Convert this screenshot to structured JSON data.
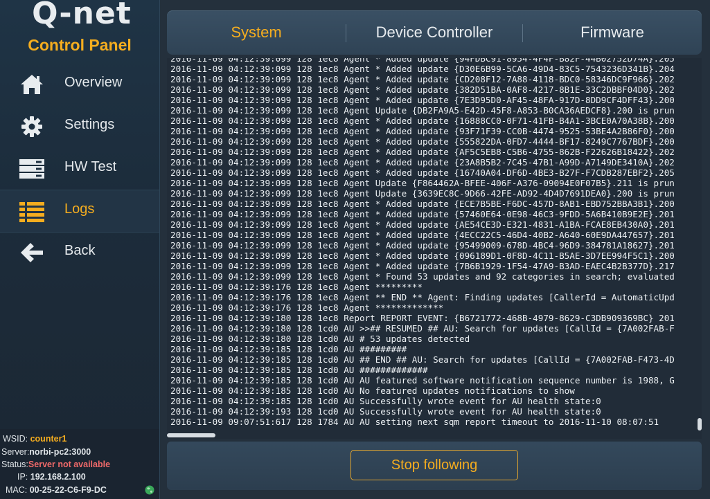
{
  "app": {
    "logo_text": "Q-net",
    "subtitle": "Control Panel"
  },
  "sidebar": {
    "items": [
      {
        "label": "Overview",
        "icon": "home-icon",
        "active": false
      },
      {
        "label": "Settings",
        "icon": "gear-icon",
        "active": false
      },
      {
        "label": "HW Test",
        "icon": "server-icon",
        "active": false
      },
      {
        "label": "Logs",
        "icon": "list-icon",
        "active": true
      },
      {
        "label": "Back",
        "icon": "arrow-left-icon",
        "active": false
      }
    ]
  },
  "info": {
    "wsid_label": "WSID:",
    "wsid_value": "counter1",
    "server_label": "Server:",
    "server_value": "norbi-pc2:3000",
    "status_label": "Status:",
    "status_value": "Server not available",
    "ip_label": "IP:",
    "ip_value": "192.168.2.100",
    "mac_label": "MAC:",
    "mac_value": "00-25-22-C6-F9-DC",
    "status_icon": "globe-icon"
  },
  "tabs": [
    {
      "label": "System",
      "active": true
    },
    {
      "label": "Device Controller",
      "active": false
    },
    {
      "label": "Firmware",
      "active": false
    }
  ],
  "log": {
    "lines": [
      "2016-11-09 04:12:39:099 128 1ec8 Agent * Added update {94FDBC91-8954-4F4F-B82F-44B02752D74A}.205",
      "2016-11-09 04:12:39:099 128 1ec8 Agent * Added update {D30E6B99-5CA6-49D4-83C5-7543236D341B}.204",
      "2016-11-09 04:12:39:099 128 1ec8 Agent * Added update {CD208F12-7A88-4118-BDC0-58346DC9F966}.202",
      "2016-11-09 04:12:39:099 128 1ec8 Agent * Added update {382D51BA-0AF8-4217-8B1E-33C2DBBF04D0}.202",
      "2016-11-09 04:12:39:099 128 1ec8 Agent * Added update {7E3D95D0-AF45-48FA-917D-8DD9CF4DFF43}.200",
      "2016-11-09 04:12:39:099 128 1ec8 Agent Update {DB2FA9A5-E42D-45F8-A853-B0CA36AEDCF8}.200 is prun",
      "2016-11-09 04:12:39:099 128 1ec8 Agent * Added update {16888CC0-0F71-41FB-B4A1-3BCE0A70A38B}.200",
      "2016-11-09 04:12:39:099 128 1ec8 Agent * Added update {93F71F39-CC0B-4474-9525-53BE4A2B86F0}.200",
      "2016-11-09 04:12:39:099 128 1ec8 Agent * Added update {555822DA-0FD7-4444-BF17-8249C7767BDF}.200",
      "2016-11-09 04:12:39:099 128 1ec8 Agent * Added update {AF5C5EB8-C5B6-4755-862B-F22626B18422}.202",
      "2016-11-09 04:12:39:099 128 1ec8 Agent * Added update {23A8B5B2-7C45-47B1-A99D-A7149DE3410A}.202",
      "2016-11-09 04:12:39:099 128 1ec8 Agent * Added update {16740A04-DF6D-4BE3-B27F-F7CDB287EBF2}.205",
      "2016-11-09 04:12:39:099 128 1ec8 Agent Update {F864462A-BFEE-406F-A376-09094E0F07B5}.211 is prun",
      "2016-11-09 04:12:39:099 128 1ec8 Agent Update {3639EC8C-9D66-42FE-AD92-4D4D7691DEA0}.200 is prun",
      "2016-11-09 04:12:39:099 128 1ec8 Agent * Added update {ECE7B5BE-F6DC-457D-8AB1-EBD752BBA3B1}.200",
      "2016-11-09 04:12:39:099 128 1ec8 Agent * Added update {57460E64-0E98-46C3-9FDD-5A6B410B9E2E}.201",
      "2016-11-09 04:12:39:099 128 1ec8 Agent * Added update {AE54CE3D-E321-4831-A1BA-FCAE8EB430A0}.201",
      "2016-11-09 04:12:39:099 128 1ec8 Agent * Added update {4ECC22C5-46D4-40B2-A640-60E9DA447657}.201",
      "2016-11-09 04:12:39:099 128 1ec8 Agent * Added update {95499009-678D-4BC4-96D9-384781A18627}.201",
      "2016-11-09 04:12:39:099 128 1ec8 Agent * Added update {096189D1-0F8D-4C11-B5AE-3D7EE994F5C1}.200",
      "2016-11-09 04:12:39:099 128 1ec8 Agent * Added update {7B6B1929-1F54-47A9-B3AD-EAEC4B2B377D}.217",
      "2016-11-09 04:12:39:099 128 1ec8 Agent * Found 53 updates and 92 categories in search; evaluated",
      "2016-11-09 04:12:39:176 128 1ec8 Agent *********",
      "2016-11-09 04:12:39:176 128 1ec8 Agent ** END ** Agent: Finding updates [CallerId = AutomaticUpd",
      "2016-11-09 04:12:39:176 128 1ec8 Agent *************",
      "2016-11-09 04:12:39:180 128 1ec8 Report REPORT EVENT: {B6721772-468B-4979-8629-C3DB909369BC} 201",
      "2016-11-09 04:12:39:180 128 1cd0 AU >>## RESUMED ## AU: Search for updates [CallId = {7A002FAB-F",
      "2016-11-09 04:12:39:180 128 1cd0 AU # 53 updates detected",
      "2016-11-09 04:12:39:185 128 1cd0 AU #########",
      "2016-11-09 04:12:39:185 128 1cd0 AU ## END ## AU: Search for updates [CallId = {7A002FAB-F473-4D",
      "2016-11-09 04:12:39:185 128 1cd0 AU #############",
      "2016-11-09 04:12:39:185 128 1cd0 AU AU featured software notification sequence number is 1988, G",
      "2016-11-09 04:12:39:185 128 1cd0 AU No featured updates notifications to show",
      "2016-11-09 04:12:39:185 128 1cd0 AU Successfully wrote event for AU health state:0",
      "2016-11-09 04:12:39:193 128 1cd0 AU Successfully wrote event for AU health state:0",
      "2016-11-09 09:07:51:617 128 1784 AU AU setting next sqm report timeout to 2016-11-10 08:07:51"
    ]
  },
  "footer": {
    "stop_label": "Stop following"
  },
  "colors": {
    "accent": "#f5ad1f",
    "error": "#f16a6a",
    "background": "#24303c"
  }
}
